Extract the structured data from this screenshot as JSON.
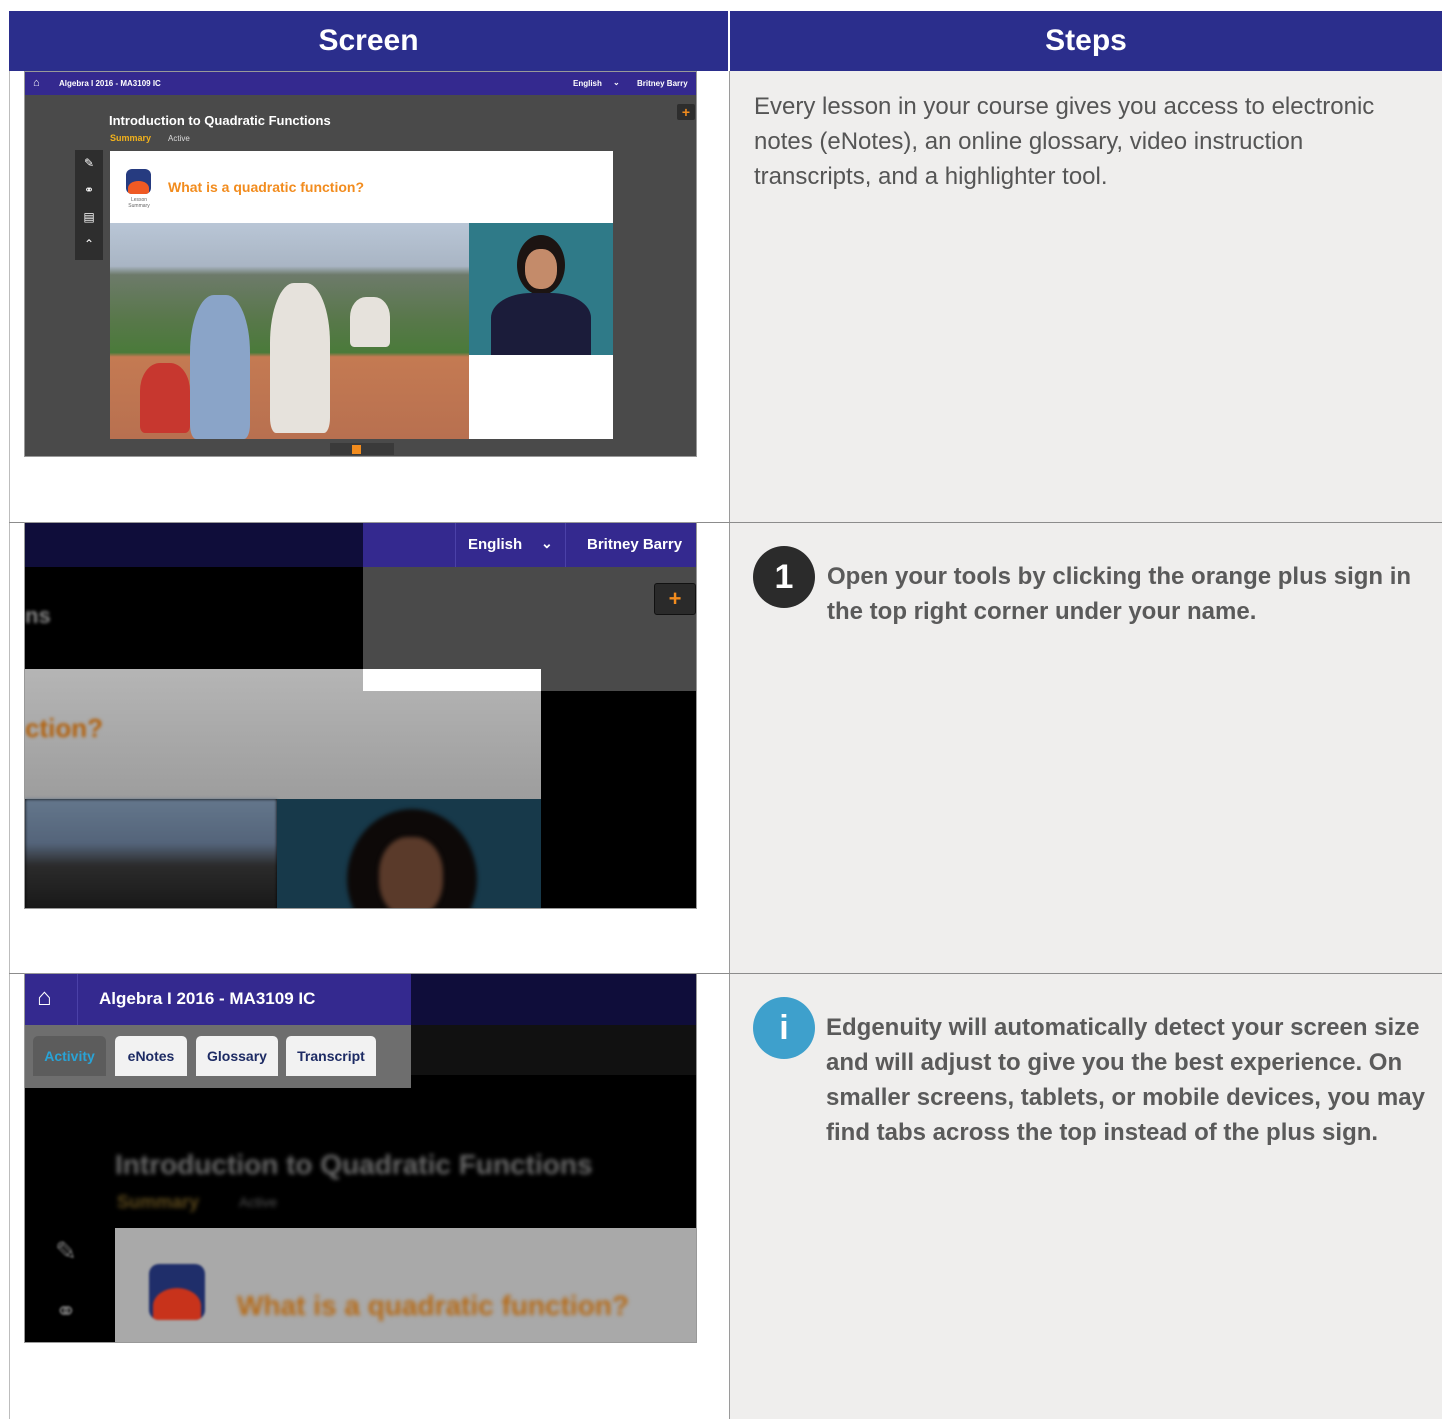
{
  "headers": {
    "screen": "Screen",
    "steps": "Steps"
  },
  "shot1": {
    "course": "Algebra I 2016 - MA3109 IC",
    "language": "English",
    "user": "Britney Barry",
    "plus": "+",
    "lesson_title": "Introduction to Quadratic Functions",
    "tab_summary": "Summary",
    "tab_active": "Active",
    "question": "What is a quadratic function?",
    "logo_label": "Lesson Summary",
    "tools": [
      "pencil-icon",
      "headphones-icon",
      "calculator-icon",
      "highlighter-icon"
    ]
  },
  "shot2": {
    "language": "English",
    "user": "Britney Barry",
    "plus": "+",
    "partial_left": "ns",
    "partial_question": "ction?"
  },
  "shot3": {
    "course": "Algebra I 2016 - MA3109 IC",
    "tabs": [
      "Activity",
      "eNotes",
      "Glossary",
      "Transcript"
    ],
    "lesson_title": "Introduction to Quadratic Functions",
    "tab_summary": "Summary",
    "tab_active": "Active",
    "question": "What is a quadratic function?"
  },
  "steps": {
    "intro": "Every lesson in your course gives you access to electronic notes (eNotes), an online glossary, video instruction transcripts, and a highlighter tool.",
    "step1_number": "1",
    "step1_text": "Open your tools by clicking the orange plus sign in the top right corner under your name.",
    "info_icon": "i",
    "info_text": "Edgenuity will automatically detect your screen size and will adjust to give you the best experience. On smaller screens, tablets, or mobile devices, you may find tabs across the top instead of the plus sign."
  },
  "colors": {
    "header_bg": "#2b2e8c",
    "accent_orange": "#f28c1e",
    "info_blue": "#3ea0cc"
  }
}
